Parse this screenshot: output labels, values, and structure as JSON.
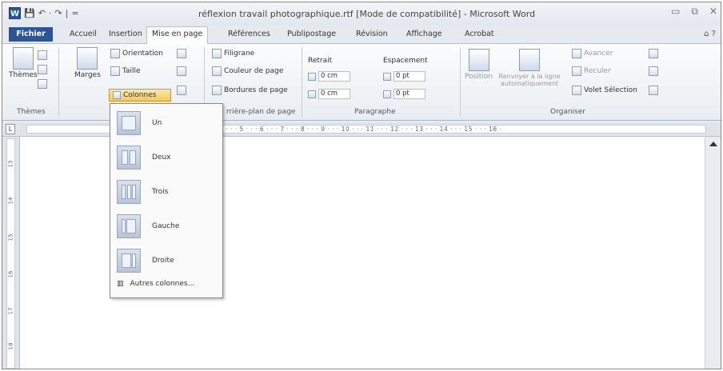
{
  "window": {
    "title": "réflexion travail photographique.rtf [Mode de compatibilité] - Microsoft Word",
    "quick_access": [
      "W",
      "💾",
      "↶",
      "·",
      "↷",
      "|",
      "="
    ],
    "buttons": [
      "▭",
      "⧉",
      "✕"
    ]
  },
  "tabs": {
    "file": "Fichier",
    "items": [
      "Accueil",
      "Insertion",
      "Mise en page",
      "Références",
      "Publipostage",
      "Révision",
      "Affichage",
      "Acrobat"
    ],
    "active": "Mise en page",
    "help": "⌂ ?"
  },
  "ribbon": {
    "themes": {
      "button": "Thèmes",
      "group": "Thèmes"
    },
    "page_setup": {
      "marges": "Marges",
      "orientation": "Orientation",
      "taille": "Taille",
      "colonnes": "Colonnes"
    },
    "background": {
      "filigrane": "Filigrane",
      "couleur": "Couleur de page",
      "bordures": "Bordures de page",
      "group": "rrière-plan de page"
    },
    "paragraph": {
      "retrait": "Retrait",
      "espacement": "Espacement",
      "retrait_left": "0 cm",
      "retrait_right": "0 cm",
      "space_before": "0 pt",
      "space_after": "0 pt",
      "group": "Paragraphe"
    },
    "arrange": {
      "position": "Position",
      "renvoyer": "Renvoyer à la ligne automatiquement",
      "avancer": "Avancer",
      "reculer": "Reculer",
      "volet": "Volet Sélection",
      "group": "Organiser"
    }
  },
  "ruler": {
    "corner": "L",
    "ticks": "4 · · · 5 · · · 6 · · · 7 · · · 8 · · · 9 · · · 10 · · · 11 · · · 12 · · · 13 · · · 14 · · · 15 · · · 16 ·",
    "vertical": [
      "13",
      "14",
      "15",
      "16",
      "17",
      "18"
    ]
  },
  "columns_menu": {
    "items": [
      "Un",
      "Deux",
      "Trois",
      "Gauche",
      "Droite"
    ],
    "more": "Autres colonnes..."
  }
}
